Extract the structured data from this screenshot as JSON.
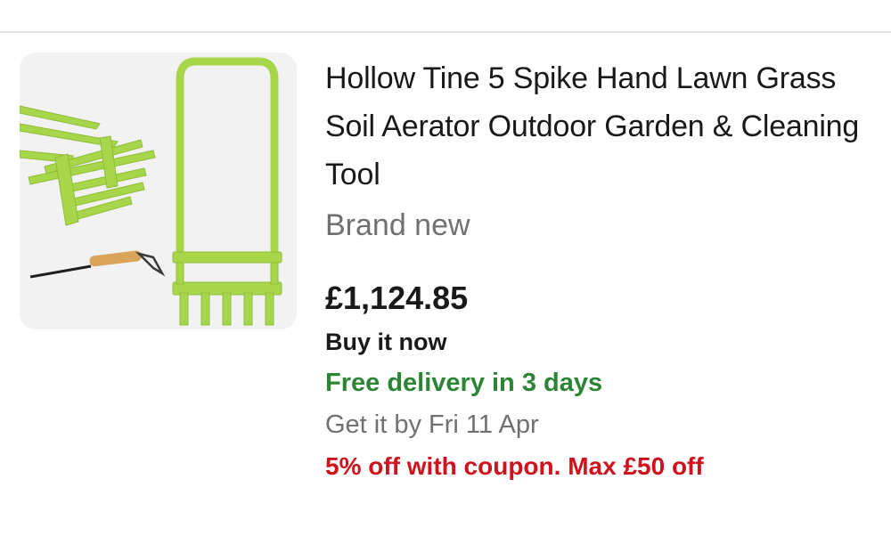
{
  "listing": {
    "title": "Hollow Tine 5 Spike Hand Lawn Grass Soil Aerator Outdoor Garden & Cleaning Tool",
    "condition": "Brand new",
    "price": "£1,124.85",
    "format": "Buy it now",
    "delivery": "Free delivery in 3 days",
    "eta": "Get it by Fri 11 Apr",
    "coupon": "5% off with coupon. Max £50 off",
    "image": {
      "icon": "product-photo-lawn-aerator",
      "tool_color": "#a8d64a",
      "handle_color": "#d9a35a"
    }
  },
  "colors": {
    "delivery": "#2c8535",
    "coupon": "#d0121d",
    "secondary_text": "#707070",
    "divider": "#e5e5e5"
  }
}
